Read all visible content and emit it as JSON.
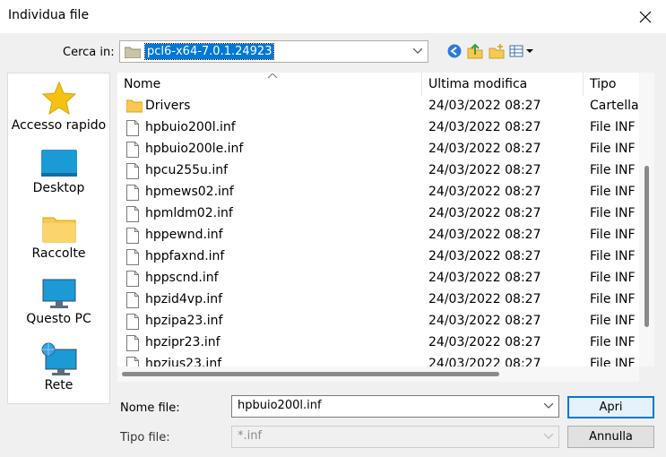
{
  "window": {
    "title": "Individua file"
  },
  "lookin": {
    "label": "Cerca in:",
    "value": "pcl6-x64-7.0.1.24923"
  },
  "toolbar": {
    "icons": [
      "back-icon",
      "up-folder-icon",
      "new-folder-icon",
      "view-menu-icon"
    ]
  },
  "places": [
    {
      "label": "Accesso rapido",
      "icon": "star-icon"
    },
    {
      "label": "Desktop",
      "icon": "desktop-icon"
    },
    {
      "label": "Raccolte",
      "icon": "libraries-icon"
    },
    {
      "label": "Questo PC",
      "icon": "computer-icon"
    },
    {
      "label": "Rete",
      "icon": "network-icon"
    }
  ],
  "columns": {
    "name": "Nome",
    "modified": "Ultima modifica",
    "type": "Tipo"
  },
  "files": [
    {
      "name": "Drivers",
      "modified": "24/03/2022 08:27",
      "type": "Cartella",
      "kind": "folder"
    },
    {
      "name": "hpbuio200l.inf",
      "modified": "24/03/2022 08:27",
      "type": "File INF",
      "kind": "file"
    },
    {
      "name": "hpbuio200le.inf",
      "modified": "24/03/2022 08:27",
      "type": "File INF",
      "kind": "file"
    },
    {
      "name": "hpcu255u.inf",
      "modified": "24/03/2022 08:27",
      "type": "File INF",
      "kind": "file"
    },
    {
      "name": "hpmews02.inf",
      "modified": "24/03/2022 08:27",
      "type": "File INF",
      "kind": "file"
    },
    {
      "name": "hpmldm02.inf",
      "modified": "24/03/2022 08:27",
      "type": "File INF",
      "kind": "file"
    },
    {
      "name": "hppewnd.inf",
      "modified": "24/03/2022 08:27",
      "type": "File INF",
      "kind": "file"
    },
    {
      "name": "hppfaxnd.inf",
      "modified": "24/03/2022 08:27",
      "type": "File INF",
      "kind": "file"
    },
    {
      "name": "hppscnd.inf",
      "modified": "24/03/2022 08:27",
      "type": "File INF",
      "kind": "file"
    },
    {
      "name": "hpzid4vp.inf",
      "modified": "24/03/2022 08:27",
      "type": "File INF",
      "kind": "file"
    },
    {
      "name": "hpzipa23.inf",
      "modified": "24/03/2022 08:27",
      "type": "File INF",
      "kind": "file"
    },
    {
      "name": "hpzipr23.inf",
      "modified": "24/03/2022 08:27",
      "type": "File INF",
      "kind": "file"
    },
    {
      "name": "hpzius23.inf",
      "modified": "24/03/2022 08:27",
      "type": "File INF",
      "kind": "file"
    }
  ],
  "filename": {
    "label": "Nome file:",
    "value": "hpbuio200l.inf"
  },
  "filetype": {
    "label": "Tipo file:",
    "value": "*.inf"
  },
  "buttons": {
    "open": "Apri",
    "cancel": "Annulla"
  },
  "colors": {
    "accent": "#0078d7",
    "folder": "#f8c952"
  }
}
